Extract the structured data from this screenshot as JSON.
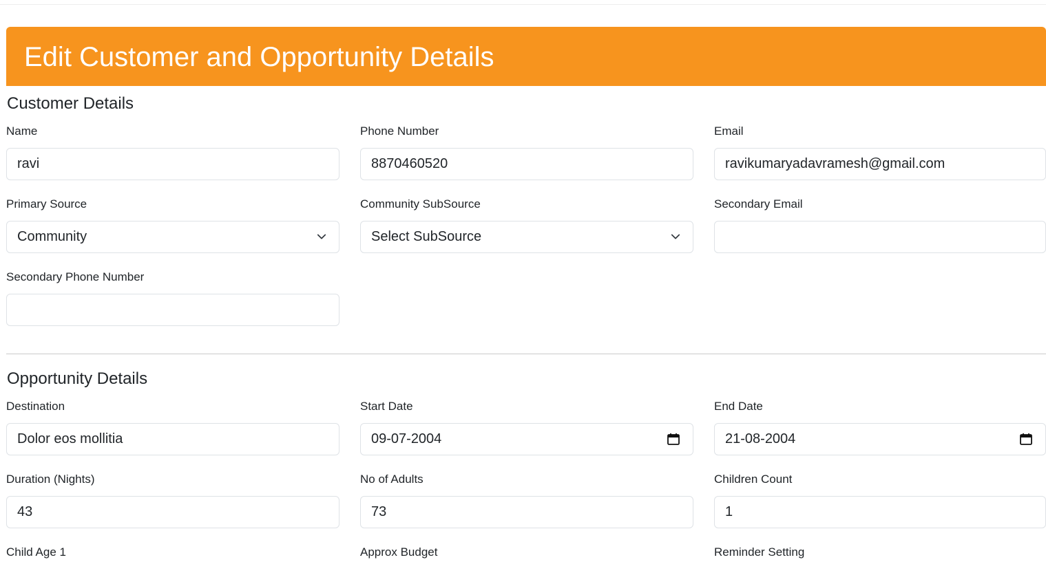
{
  "header": {
    "title": "Edit Customer and Opportunity Details"
  },
  "customer": {
    "section_title": "Customer Details",
    "name": {
      "label": "Name",
      "value": "ravi"
    },
    "phone": {
      "label": "Phone Number",
      "value": "8870460520"
    },
    "email": {
      "label": "Email",
      "value": "ravikumaryadavramesh@gmail.com"
    },
    "primary_source": {
      "label": "Primary Source",
      "value": "Community"
    },
    "subsource": {
      "label": "Community SubSource",
      "value": "Select SubSource"
    },
    "secondary_email": {
      "label": "Secondary Email",
      "value": ""
    },
    "secondary_phone": {
      "label": "Secondary Phone Number",
      "value": ""
    }
  },
  "opportunity": {
    "section_title": "Opportunity Details",
    "destination": {
      "label": "Destination",
      "value": "Dolor eos mollitia"
    },
    "start_date": {
      "label": "Start Date",
      "value": "09-07-2004"
    },
    "end_date": {
      "label": "End Date",
      "value": "21-08-2004"
    },
    "duration": {
      "label": "Duration (Nights)",
      "value": "43"
    },
    "adults": {
      "label": "No of Adults",
      "value": "73"
    },
    "children": {
      "label": "Children Count",
      "value": "1"
    },
    "child_age_1": {
      "label": "Child Age 1"
    },
    "budget": {
      "label": "Approx Budget"
    },
    "reminder": {
      "label": "Reminder Setting"
    }
  },
  "icons": {
    "select_arrow": "chevron-down-icon",
    "date_picker": "calendar-icon"
  },
  "colors": {
    "accent": "#f7941e",
    "border": "#dee2e6",
    "text": "#212529"
  }
}
